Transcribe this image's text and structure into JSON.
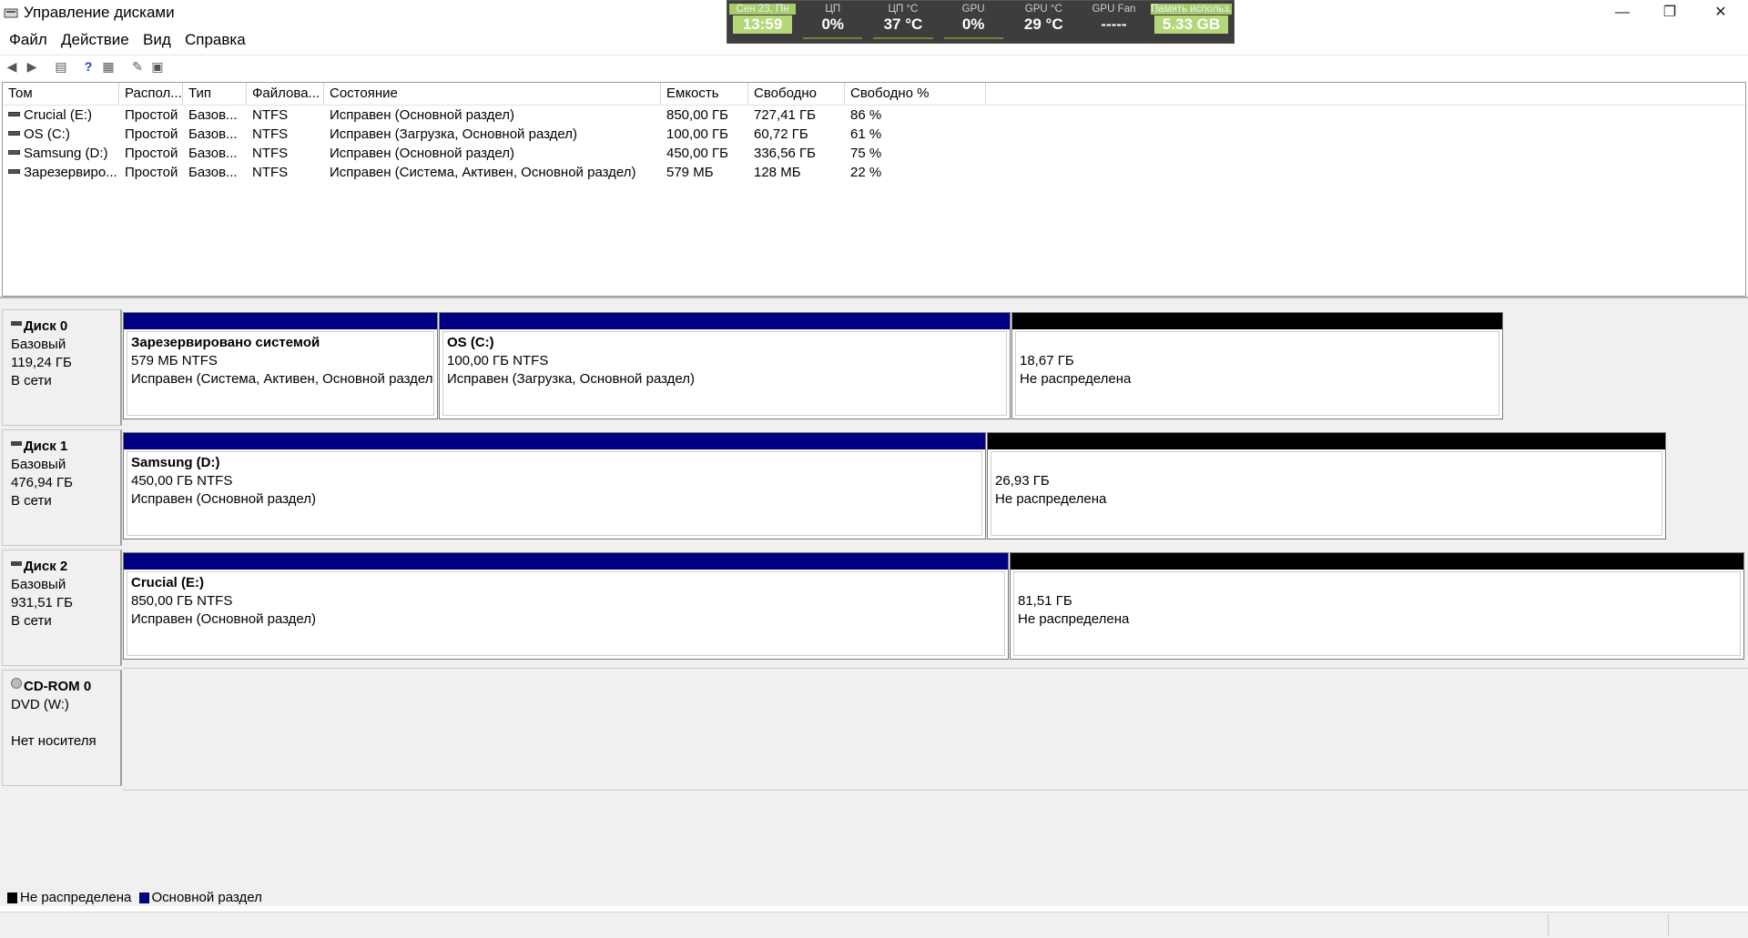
{
  "window": {
    "title": "Управление дисками"
  },
  "monitor": [
    {
      "label": "Сен 23, Пн",
      "value": "13:59",
      "highlight": true
    },
    {
      "label": "ЦП",
      "value": "0%",
      "highlight": false
    },
    {
      "label": "ЦП °C",
      "value": "37 °C",
      "highlight": false
    },
    {
      "label": "GPU",
      "value": "0%",
      "highlight": false
    },
    {
      "label": "GPU °C",
      "value": "29 °C",
      "highlight": false
    },
    {
      "label": "GPU Fan",
      "value": "-----",
      "highlight": false
    },
    {
      "label": "Память использ.",
      "value": "5.33 GB",
      "highlight": true
    }
  ],
  "menu": [
    "Файл",
    "Действие",
    "Вид",
    "Справка"
  ],
  "toolbar_icons": [
    "back-arrow-icon",
    "forward-arrow-icon",
    "show-hide-tree-icon",
    "help-icon",
    "properties-icon",
    "rescan-icon",
    "settings-icon"
  ],
  "columns": [
    "Том",
    "Распол...",
    "Тип",
    "Файлова...",
    "Состояние",
    "Емкость",
    "Свободно",
    "Свободно %"
  ],
  "volumes": [
    [
      "Crucial (E:)",
      "Простой",
      "Базов...",
      "NTFS",
      "Исправен (Основной раздел)",
      "850,00 ГБ",
      "727,41 ГБ",
      "86 %"
    ],
    [
      "OS (C:)",
      "Простой",
      "Базов...",
      "NTFS",
      "Исправен (Загрузка, Основной раздел)",
      "100,00 ГБ",
      "60,72 ГБ",
      "61 %"
    ],
    [
      "Samsung (D:)",
      "Простой",
      "Базов...",
      "NTFS",
      "Исправен (Основной раздел)",
      "450,00 ГБ",
      "336,56 ГБ",
      "75 %"
    ],
    [
      "Зарезервиро...",
      "Простой",
      "Базов...",
      "NTFS",
      "Исправен (Система, Активен, Основной раздел)",
      "579 МБ",
      "128 МБ",
      "22 %"
    ]
  ],
  "disks": [
    {
      "name": "Диск 0",
      "type": "Базовый",
      "size": "119,24 ГБ",
      "status": "В сети",
      "partitions": [
        {
          "kind": "primary",
          "name": "Зарезервировано системой",
          "size": "579 МБ NTFS",
          "state": "Исправен (Система, Активен, Основной раздел"
        },
        {
          "kind": "primary",
          "name": "OS  (C:)",
          "size": "100,00 ГБ NTFS",
          "state": "Исправен (Загрузка, Основной раздел)"
        },
        {
          "kind": "unalloc",
          "name": "",
          "size": "18,67 ГБ",
          "state": "Не распределена"
        }
      ]
    },
    {
      "name": "Диск 1",
      "type": "Базовый",
      "size": "476,94 ГБ",
      "status": "В сети",
      "partitions": [
        {
          "kind": "primary",
          "name": "Samsung  (D:)",
          "size": "450,00 ГБ NTFS",
          "state": "Исправен (Основной раздел)"
        },
        {
          "kind": "unalloc",
          "name": "",
          "size": "26,93 ГБ",
          "state": "Не распределена"
        }
      ]
    },
    {
      "name": "Диск 2",
      "type": "Базовый",
      "size": "931,51 ГБ",
      "status": "В сети",
      "partitions": [
        {
          "kind": "primary",
          "name": "Crucial  (E:)",
          "size": "850,00 ГБ NTFS",
          "state": "Исправен (Основной раздел)"
        },
        {
          "kind": "unalloc",
          "name": "",
          "size": "81,51 ГБ",
          "state": "Не распределена"
        }
      ]
    }
  ],
  "cdrom": {
    "name": "CD-ROM 0",
    "drive": "DVD (W:)",
    "status": "Нет носителя"
  },
  "legend": {
    "unallocated": "Не распределена",
    "primary": "Основной раздел"
  },
  "colors": {
    "primary": "#000080",
    "unallocated": "#000000",
    "monitor_highlight": "#b4d77a"
  }
}
